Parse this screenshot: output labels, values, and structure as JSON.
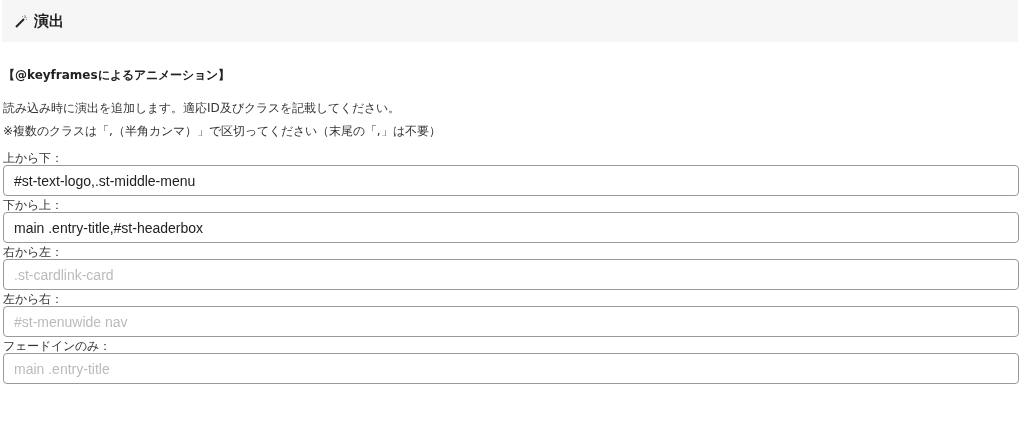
{
  "section": {
    "title": "演出"
  },
  "subheading": "【@keyframesによるアニメーション】",
  "description": [
    "読み込み時に演出を追加します。適応ID及びクラスを記載してください。",
    "※複数のクラスは「,（半角カンマ）」で区切ってください（末尾の「,」は不要）"
  ],
  "fields": [
    {
      "label": "上から下：",
      "value": "#st-text-logo,.st-middle-menu"
    },
    {
      "label": "下から上：",
      "value": "main .entry-title,#st-headerbox"
    },
    {
      "label": "右から左：",
      "placeholder": ".st-cardlink-card"
    },
    {
      "label": "左から右：",
      "placeholder": "#st-menuwide nav"
    },
    {
      "label": "フェードインのみ：",
      "placeholder": "main .entry-title"
    }
  ]
}
